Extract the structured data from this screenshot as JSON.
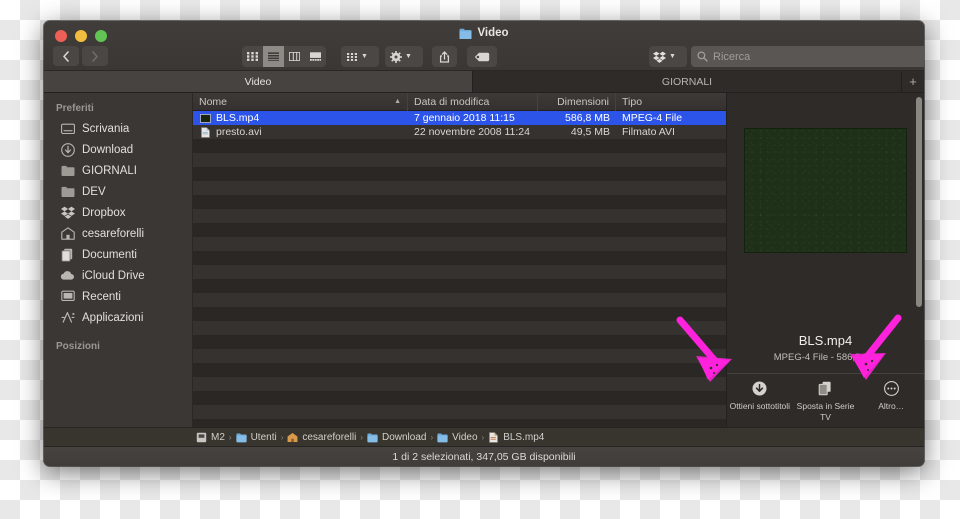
{
  "window": {
    "title": "Video",
    "title_icon": "folder-icon"
  },
  "toolbar": {
    "back_icon": "chevron-left-icon",
    "forward_icon": "chevron-right-icon",
    "view_icons": [
      "grid-view-icon",
      "list-view-icon",
      "column-view-icon",
      "gallery-view-icon"
    ],
    "arrange_icon": "arrange-grid-icon",
    "action_icon": "gear-icon",
    "share_icon": "share-icon",
    "tag_icon": "tag-icon",
    "dropbox_icon": "dropbox-icon",
    "chevron_icon": "chevron-down-icon"
  },
  "search": {
    "icon": "search-icon",
    "placeholder": "Ricerca",
    "value": ""
  },
  "tabs": {
    "items": [
      {
        "label": "Video",
        "active": true
      },
      {
        "label": "GIORNALI",
        "active": false
      }
    ],
    "add_label": "+"
  },
  "sidebar": {
    "sections": [
      {
        "header": "Preferiti",
        "items": [
          {
            "label": "Scrivania",
            "icon": "desktop-icon"
          },
          {
            "label": "Download",
            "icon": "download-icon"
          },
          {
            "label": "GIORNALI",
            "icon": "folder-icon"
          },
          {
            "label": "DEV",
            "icon": "folder-icon"
          },
          {
            "label": "Dropbox",
            "icon": "dropbox-icon"
          },
          {
            "label": "cesareforelli",
            "icon": "home-icon"
          },
          {
            "label": "Documenti",
            "icon": "documents-icon"
          },
          {
            "label": "iCloud Drive",
            "icon": "cloud-icon"
          },
          {
            "label": "Recenti",
            "icon": "recents-icon"
          },
          {
            "label": "Applicazioni",
            "icon": "applications-icon"
          }
        ]
      },
      {
        "header": "Posizioni",
        "items": []
      }
    ]
  },
  "filelist": {
    "columns": [
      {
        "key": "name",
        "label": "Nome",
        "sort": "ascending",
        "sort_icon": "chevron-up-icon"
      },
      {
        "key": "date",
        "label": "Data di modifica"
      },
      {
        "key": "size",
        "label": "Dimensioni"
      },
      {
        "key": "type",
        "label": "Tipo"
      }
    ],
    "rows": [
      {
        "name": "BLS.mp4",
        "date": "7 gennaio 2018 11:15",
        "size": "586,8 MB",
        "type": "MPEG-4 File",
        "icon": "video-thumbnail-icon",
        "selected": true
      },
      {
        "name": "presto.avi",
        "date": "22 novembre 2008 11:24",
        "size": "49,5 MB",
        "type": "Filmato AVI",
        "icon": "document-icon",
        "selected": false
      }
    ]
  },
  "preview": {
    "thumbnail_icon": "video-preview-thumbnail",
    "name": "BLS.mp4",
    "subtitle": "MPEG-4 File - 586,8 MB",
    "actions": [
      {
        "label": "Ottieni sottotitoli",
        "icon": "download-circle-icon"
      },
      {
        "label": "Sposta in Serie TV",
        "icon": "copy-documents-icon"
      },
      {
        "label": "Altro…",
        "icon": "ellipsis-circle-icon"
      }
    ]
  },
  "pathbar": {
    "separator": "›",
    "items": [
      {
        "label": "M2",
        "icon": "disk-icon"
      },
      {
        "label": "Utenti",
        "icon": "folder-icon"
      },
      {
        "label": "cesareforelli",
        "icon": "home-icon"
      },
      {
        "label": "Download",
        "icon": "folder-icon"
      },
      {
        "label": "Video",
        "icon": "folder-icon"
      },
      {
        "label": "BLS.mp4",
        "icon": "file-icon"
      }
    ]
  },
  "statusbar": {
    "text": "1 di 2 selezionati, 347,05 GB disponibili"
  },
  "annotations": {
    "color": "#ff22dd",
    "marks": [
      {
        "name": "arrow-left-pointing-down-right"
      },
      {
        "name": "arrow-right-pointing-down-left"
      }
    ]
  }
}
